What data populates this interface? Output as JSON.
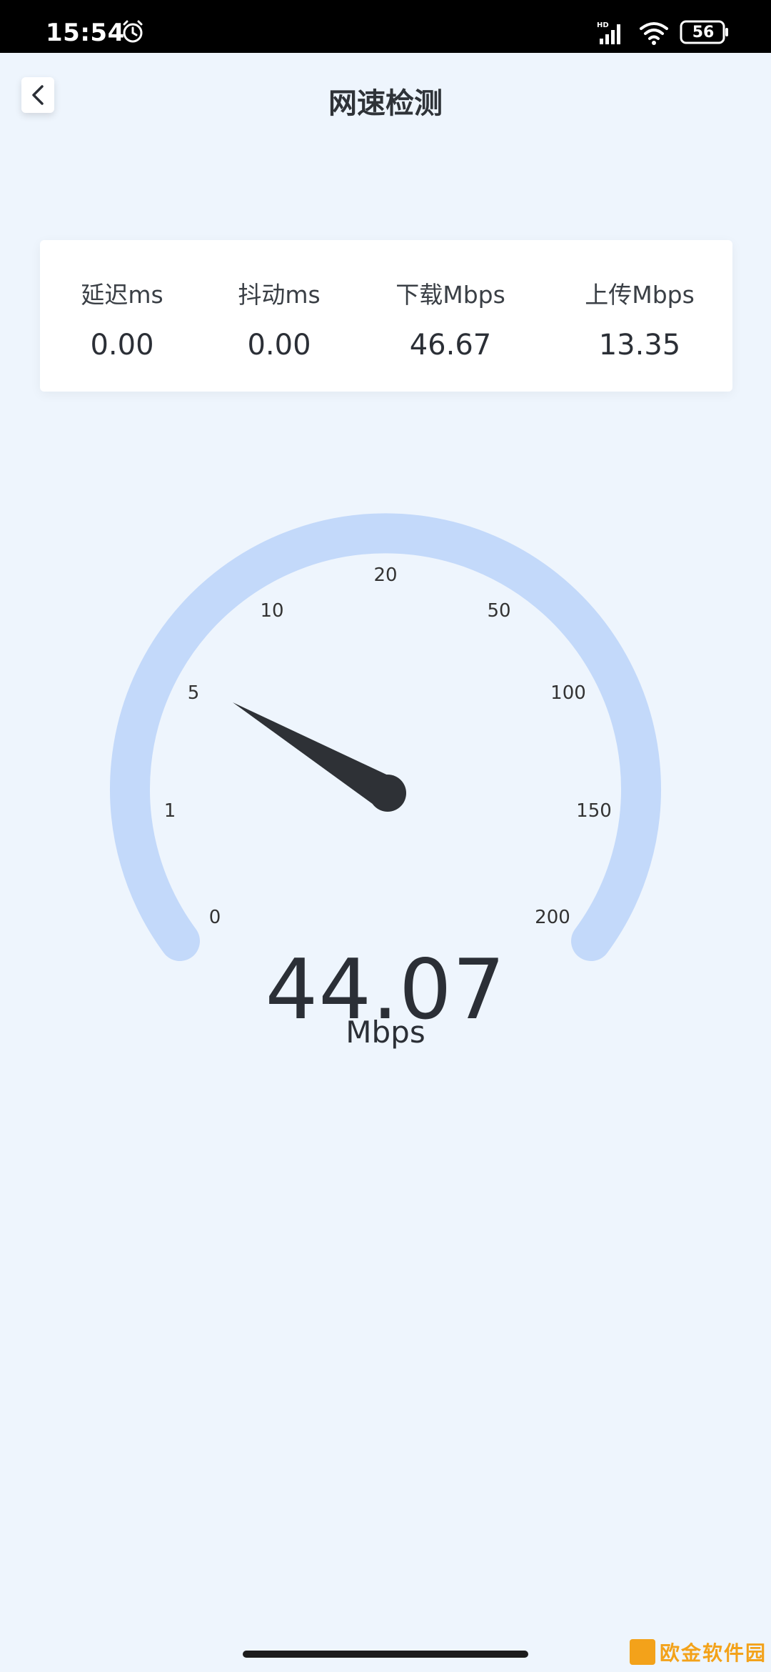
{
  "status_bar": {
    "time": "15:54",
    "battery": "56",
    "icons": [
      "alarm-icon",
      "signal-icon",
      "wifi-icon",
      "battery-icon"
    ]
  },
  "header": {
    "title": "网速检测",
    "back_icon": "chevron-left-icon"
  },
  "stats": [
    {
      "label": "延迟ms",
      "value": "0.00"
    },
    {
      "label": "抖动ms",
      "value": "0.00"
    },
    {
      "label": "下载Mbps",
      "value": "46.67"
    },
    {
      "label": "上传Mbps",
      "value": "13.35"
    }
  ],
  "gauge": {
    "tick_labels": [
      "0",
      "1",
      "5",
      "10",
      "20",
      "50",
      "100",
      "150",
      "200"
    ],
    "needle_points_to": "5",
    "arc_color": "#c3d9fa",
    "needle_color": "#2e3136"
  },
  "speed": {
    "value": "44.07",
    "unit": "Mbps"
  },
  "watermark": {
    "text": "欧金软件园"
  },
  "colors": {
    "background": "#eef5fd",
    "card": "#ffffff",
    "text": "#2b2f36"
  }
}
